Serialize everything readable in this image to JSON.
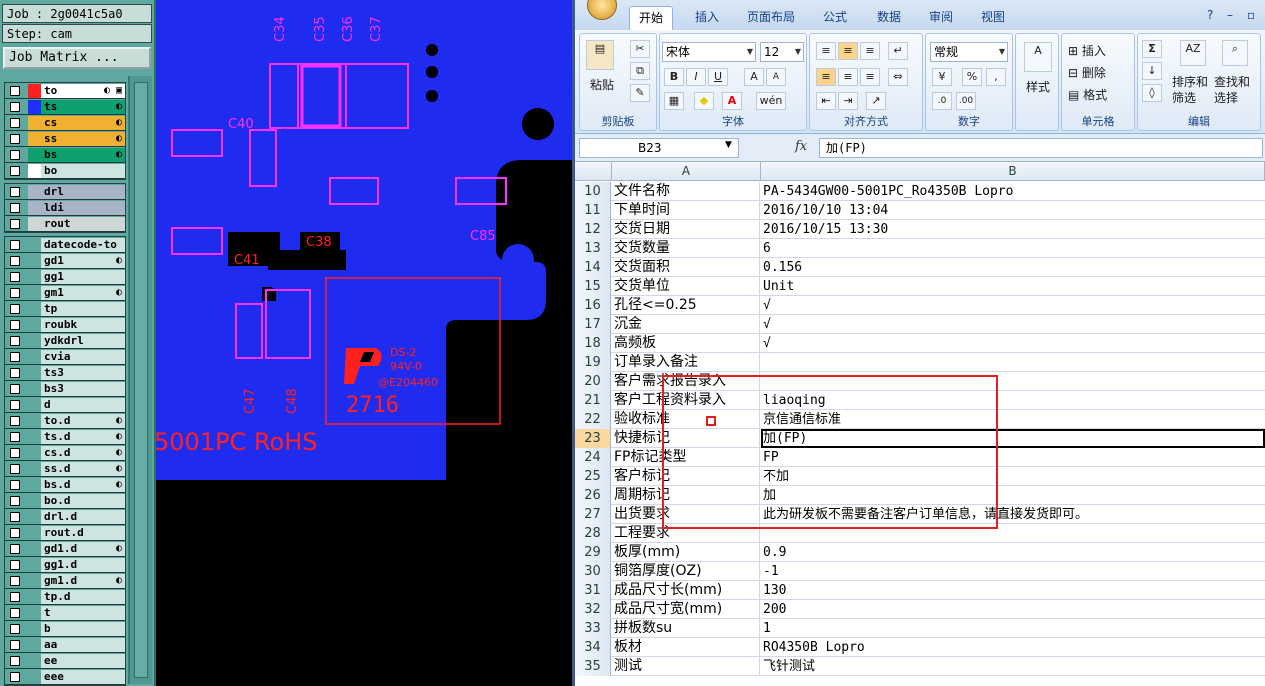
{
  "cam": {
    "job": "Job : 2g0041c5a0",
    "step": "Step: cam",
    "job_matrix": "Job Matrix ...",
    "layer_groups": [
      {
        "layers": [
          {
            "name": "to",
            "color": "#ff2020",
            "flag": "◐ ▣",
            "highlight": true
          },
          {
            "name": "ts",
            "color": "#2030ff",
            "flag": "◐"
          },
          {
            "name": "cs",
            "color": "#f0b030",
            "flag": "◐"
          },
          {
            "name": "ss",
            "color": "#f0b030",
            "flag": "◐"
          },
          {
            "name": "bs",
            "color": "#10a070",
            "flag": "◐"
          },
          {
            "name": "bo",
            "color": "#ffffff",
            "flag": ""
          }
        ]
      },
      {
        "layers": [
          {
            "name": "drl",
            "color": "#aab4c8",
            "flag": ""
          },
          {
            "name": "ldi",
            "color": "#aab4c8",
            "flag": ""
          },
          {
            "name": "rout",
            "color": "#cfd6d6",
            "flag": ""
          }
        ]
      },
      {
        "layers": [
          {
            "name": "datecode-to",
            "flag": ""
          },
          {
            "name": "gd1",
            "flag": "◐"
          },
          {
            "name": "gg1",
            "flag": ""
          },
          {
            "name": "gm1",
            "flag": "◐"
          },
          {
            "name": "tp",
            "flag": ""
          },
          {
            "name": "roubk",
            "flag": ""
          },
          {
            "name": "ydkdrl",
            "flag": ""
          },
          {
            "name": "cvia",
            "flag": ""
          },
          {
            "name": "ts3",
            "flag": ""
          },
          {
            "name": "bs3",
            "flag": ""
          },
          {
            "name": "d",
            "flag": ""
          },
          {
            "name": "to.d",
            "flag": "◐"
          },
          {
            "name": "ts.d",
            "flag": "◐"
          },
          {
            "name": "cs.d",
            "flag": "◐"
          },
          {
            "name": "ss.d",
            "flag": "◐"
          },
          {
            "name": "bs.d",
            "flag": "◐"
          },
          {
            "name": "bo.d",
            "flag": ""
          },
          {
            "name": "drl.d",
            "flag": ""
          },
          {
            "name": "rout.d",
            "flag": ""
          },
          {
            "name": "gd1.d",
            "flag": "◐"
          },
          {
            "name": "gg1.d",
            "flag": ""
          },
          {
            "name": "gm1.d",
            "flag": "◐"
          },
          {
            "name": "tp.d",
            "flag": ""
          },
          {
            "name": "t",
            "flag": ""
          },
          {
            "name": "b",
            "flag": ""
          },
          {
            "name": "aa",
            "flag": ""
          },
          {
            "name": "ee",
            "flag": ""
          },
          {
            "name": "eee",
            "flag": ""
          }
        ]
      }
    ]
  },
  "pcb": {
    "labels": {
      "c34": "C34",
      "c35": "C35",
      "c36": "C36",
      "c37": "C37",
      "c40": "C40",
      "c38": "C38",
      "c85": "C85",
      "c41": "C41",
      "c47": "C47",
      "c48": "C48"
    },
    "marking": {
      "ds": "DS-2",
      "rating": "94V-0",
      "e_number": "@E204460",
      "date_code": "2716",
      "bottom_text": "5001PC RoHS"
    },
    "colors": {
      "copper": "#1f2cf0",
      "silk_magenta": "#ff30ff",
      "red": "#ff2020"
    }
  },
  "excel": {
    "tabs": [
      "开始",
      "插入",
      "页面布局",
      "公式",
      "数据",
      "审阅",
      "视图"
    ],
    "active_tab": "开始",
    "clipboard": {
      "paste": "粘贴",
      "label": "剪贴板"
    },
    "font": {
      "name": "宋体",
      "size": "12",
      "label": "字体"
    },
    "alignment": {
      "label": "对齐方式"
    },
    "number": {
      "format": "常规",
      "label": "数字"
    },
    "styles": {
      "label": "样式"
    },
    "cells": {
      "insert": "插入",
      "delete": "删除",
      "format": "格式",
      "label": "单元格"
    },
    "editing": {
      "sort": "排序和\n筛选",
      "find": "查找和\n选择",
      "label": "编辑"
    },
    "name_box": "B23",
    "fx": "fx",
    "formula": "加(FP)",
    "columns": [
      "A",
      "B"
    ],
    "rows": [
      {
        "n": "10",
        "a": "文件名称",
        "b": "PA-5434GW00-5001PC_Ro4350B Lopro"
      },
      {
        "n": "11",
        "a": "下单时间",
        "b": "2016/10/10 13:04"
      },
      {
        "n": "12",
        "a": "交货日期",
        "b": "2016/10/15 13:30"
      },
      {
        "n": "13",
        "a": "交货数量",
        "b": "6"
      },
      {
        "n": "14",
        "a": "交货面积",
        "b": "0.156"
      },
      {
        "n": "15",
        "a": "交货单位",
        "b": "Unit"
      },
      {
        "n": "16",
        "a": "孔径<=0.25",
        "b": "√"
      },
      {
        "n": "17",
        "a": "沉金",
        "b": "√"
      },
      {
        "n": "18",
        "a": "高频板",
        "b": "√"
      },
      {
        "n": "19",
        "a": "订单录入备注",
        "b": ""
      },
      {
        "n": "20",
        "a": "客户需求报告录入",
        "b": ""
      },
      {
        "n": "21",
        "a": "客户工程资料录入",
        "b": "liaoqing"
      },
      {
        "n": "22",
        "a": "验收标准",
        "b": "京信通信标准"
      },
      {
        "n": "23",
        "a": "快捷标记",
        "b": "加(FP)",
        "active": true
      },
      {
        "n": "24",
        "a": "FP标记类型",
        "b": "FP"
      },
      {
        "n": "25",
        "a": "客户标记",
        "b": "不加"
      },
      {
        "n": "26",
        "a": "周期标记",
        "b": "加"
      },
      {
        "n": "27",
        "a": "出货要求",
        "b": "此为研发板不需要备注客户订单信息，请直接发货即可。"
      },
      {
        "n": "28",
        "a": "工程要求",
        "b": ""
      },
      {
        "n": "29",
        "a": "板厚(mm)",
        "b": "0.9"
      },
      {
        "n": "30",
        "a": "铜箔厚度(OZ)",
        "b": "-1"
      },
      {
        "n": "31",
        "a": "成品尺寸长(mm)",
        "b": "130"
      },
      {
        "n": "32",
        "a": "成品尺寸宽(mm)",
        "b": "200"
      },
      {
        "n": "33",
        "a": "拼板数su",
        "b": "1"
      },
      {
        "n": "34",
        "a": "板材",
        "b": "RO4350B Lopro"
      },
      {
        "n": "35",
        "a": "测试",
        "b": "飞针测试"
      }
    ]
  }
}
